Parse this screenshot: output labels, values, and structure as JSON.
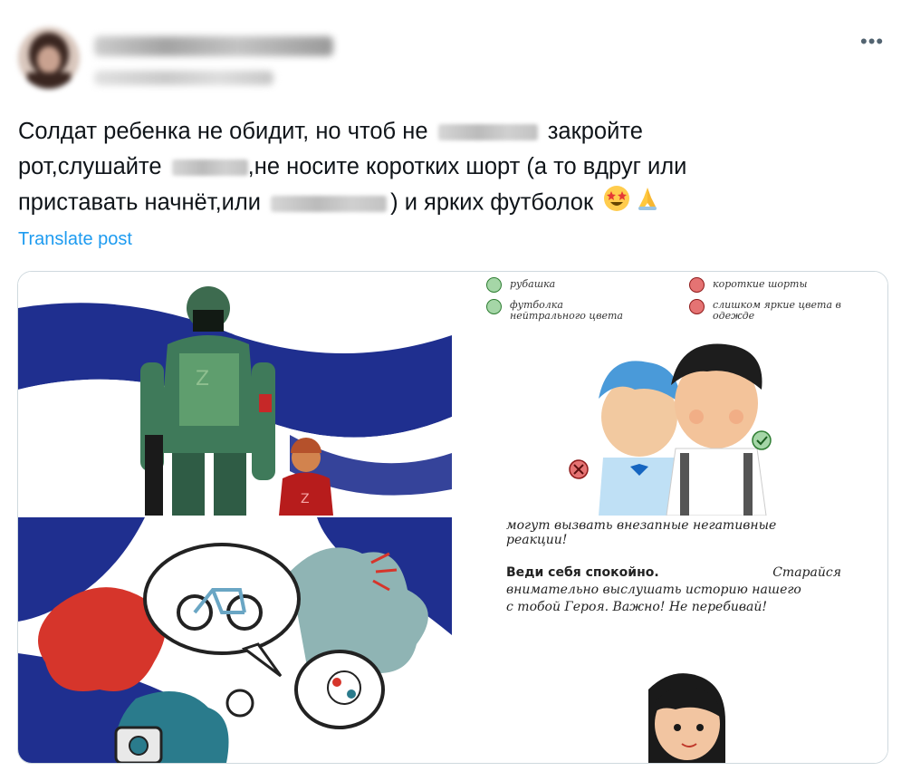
{
  "author": {
    "name": "Трефилова Дарья Евгеньевна",
    "handle": "@DarjaTrefilova"
  },
  "tweet": {
    "line1_a": "Солдат ребенка не обидит, но чтоб не",
    "line1_b": "закройте",
    "line2_a": "рот,слушайте",
    "line2_b": ",не носите коротких шорт (а то вдруг или",
    "line3_a": "приставать начнёт,или",
    "line3_b": ") и ярких футболок",
    "emojis": "🤩🙏"
  },
  "translate_label": "Translate post",
  "more_icon": "•••",
  "media": {
    "panel2": {
      "ok_items": [
        "рубашка",
        "футболка нейтрального цвета"
      ],
      "no_items": [
        "короткие шорты",
        "слишком яркие цвета в одежде"
      ]
    },
    "panel4": {
      "line1": "могут вызвать внезапные негативные",
      "line2": "реакции!",
      "bold_phrase": "Веди себя спокойно.",
      "line3_rest": "Старайся",
      "line4": "внимательно выслушать историю нашего",
      "line5": "с тобой Героя. Важно! Не перебивай!"
    }
  }
}
